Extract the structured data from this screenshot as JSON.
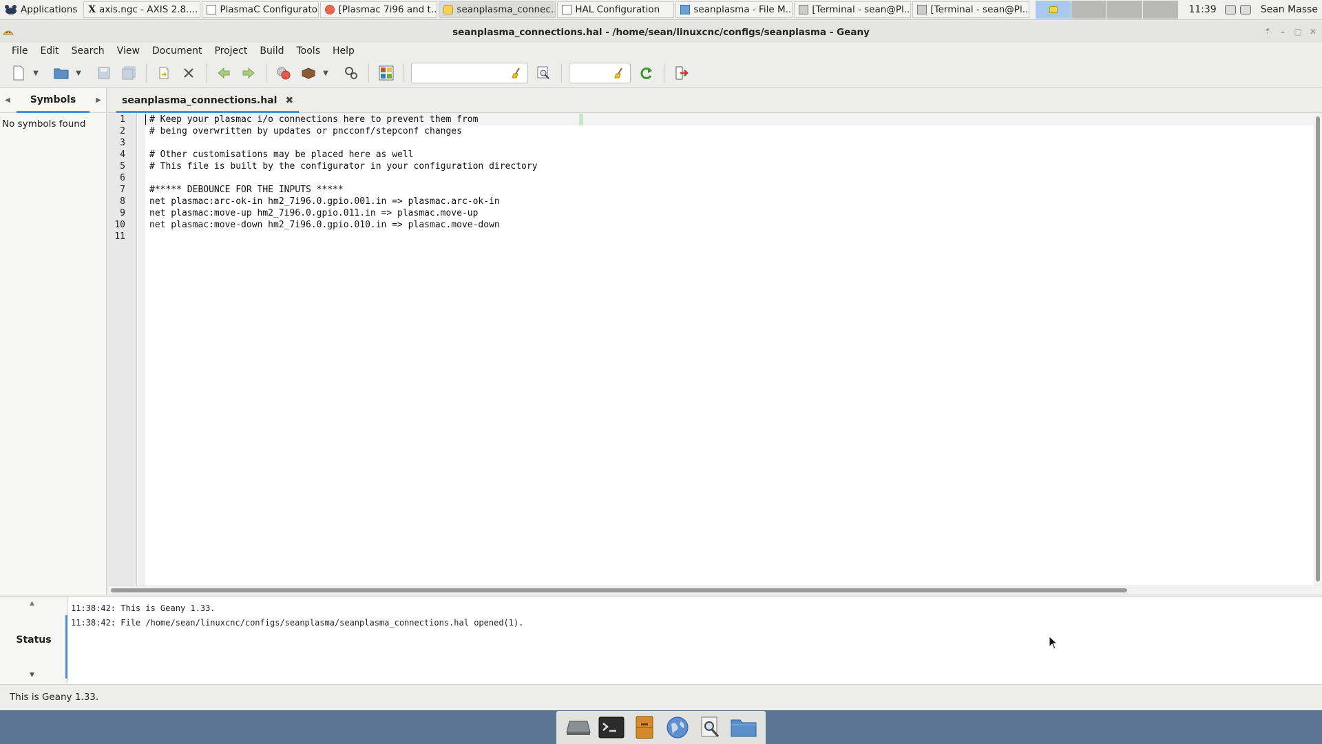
{
  "panel": {
    "applications_label": "Applications",
    "tasks": [
      {
        "icon": "X",
        "label": "axis.ngc - AXIS 2.8...."
      },
      {
        "icon": "",
        "label": "PlasmaC Configurator"
      },
      {
        "icon": "",
        "label": "[Plasmac 7i96 and t..."
      },
      {
        "icon": "",
        "label": "seanplasma_connec..."
      },
      {
        "icon": "",
        "label": "HAL Configuration"
      },
      {
        "icon": "",
        "label": "seanplasma - File M..."
      },
      {
        "icon": "",
        "label": "[Terminal - sean@Pl..."
      },
      {
        "icon": "",
        "label": "[Terminal - sean@Pl..."
      }
    ],
    "active_task_index": 3,
    "clock": "11:39",
    "user": "Sean Masse"
  },
  "window": {
    "title": "seanplasma_connections.hal - /home/sean/linuxcnc/configs/seanplasma - Geany"
  },
  "menu": {
    "items": [
      "File",
      "Edit",
      "Search",
      "View",
      "Document",
      "Project",
      "Build",
      "Tools",
      "Help"
    ]
  },
  "toolbar": {
    "search_value": "",
    "goto_value": ""
  },
  "sidebar": {
    "tab_label": "Symbols",
    "empty_text": "No symbols found"
  },
  "editor": {
    "tab_label": "seanplasma_connections.hal",
    "close_glyph": "✖",
    "line_numbers": [
      "1",
      "2",
      "3",
      "4",
      "5",
      "6",
      "7",
      "8",
      "9",
      "10",
      "11"
    ],
    "lines": [
      "# Keep your plasmac i/o connections here to prevent them from",
      "# being overwritten by updates or pncconf/stepconf changes",
      "",
      "# Other customisations may be placed here as well",
      "# This file is built by the configurator in your configuration directory",
      "",
      "#***** DEBOUNCE FOR THE INPUTS *****",
      "net plasmac:arc-ok-in hm2_7i96.0.gpio.001.in => plasmac.arc-ok-in",
      "net plasmac:move-up hm2_7i96.0.gpio.011.in => plasmac.move-up",
      "net plasmac:move-down hm2_7i96.0.gpio.010.in => plasmac.move-down",
      ""
    ]
  },
  "messages": {
    "tab_label": "Status",
    "lines": [
      "11:38:42: This is Geany 1.33.",
      "11:38:42: File /home/sean/linuxcnc/configs/seanplasma/seanplasma_connections.hal opened(1)."
    ]
  },
  "statusbar": {
    "text": "This is Geany 1.33."
  },
  "colors": {
    "accent": "#4a90d9",
    "desktop": "#5c7592"
  }
}
